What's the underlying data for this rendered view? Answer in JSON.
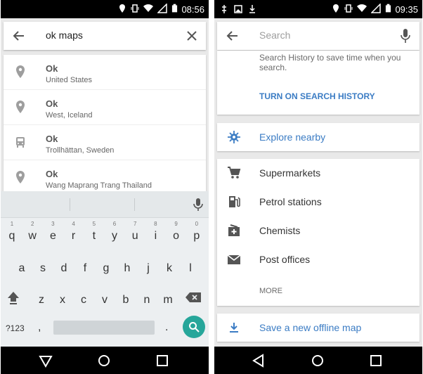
{
  "colors": {
    "accent_blue": "#3b7cc4",
    "fab_teal": "#26a69a",
    "icon_grey": "#8a8a8a"
  },
  "left": {
    "status": {
      "time": "08:56"
    },
    "search": {
      "query": "ok maps"
    },
    "results": [
      {
        "icon": "pin-icon",
        "title": "Ok",
        "subtitle": "United States"
      },
      {
        "icon": "pin-icon",
        "title": "Ok",
        "subtitle": "West, Iceland"
      },
      {
        "icon": "transit-icon",
        "title": "Ok",
        "subtitle": "Trollhättan, Sweden"
      },
      {
        "icon": "pin-icon",
        "title": "Ok",
        "subtitle": "Wang Maprang Trang Thailand"
      }
    ],
    "keyboard": {
      "row1": [
        {
          "k": "q",
          "h": "1"
        },
        {
          "k": "w",
          "h": "2"
        },
        {
          "k": "e",
          "h": "3"
        },
        {
          "k": "r",
          "h": "4"
        },
        {
          "k": "t",
          "h": "5"
        },
        {
          "k": "y",
          "h": "6"
        },
        {
          "k": "u",
          "h": "7"
        },
        {
          "k": "i",
          "h": "8"
        },
        {
          "k": "o",
          "h": "9"
        },
        {
          "k": "p",
          "h": "0"
        }
      ],
      "row2": [
        "a",
        "s",
        "d",
        "f",
        "g",
        "h",
        "j",
        "k",
        "l"
      ],
      "row3": [
        "z",
        "x",
        "c",
        "v",
        "b",
        "n",
        "m"
      ],
      "symbols_label": "?123",
      "comma": ",",
      "period": "."
    }
  },
  "right": {
    "status": {
      "time": "09:35"
    },
    "search": {
      "placeholder": "Search"
    },
    "history": {
      "text": "Search History to save time when you search.",
      "link": "TURN ON SEARCH HISTORY"
    },
    "explore": {
      "label": "Explore nearby",
      "icon": "explore-icon"
    },
    "categories": [
      {
        "icon": "cart-icon",
        "label": "Supermarkets"
      },
      {
        "icon": "fuel-icon",
        "label": "Petrol stations"
      },
      {
        "icon": "pharmacy-icon",
        "label": "Chemists"
      },
      {
        "icon": "mail-icon",
        "label": "Post offices"
      }
    ],
    "more_label": "MORE",
    "offline": {
      "label": "Save a new offline map",
      "icon": "download-icon"
    }
  }
}
